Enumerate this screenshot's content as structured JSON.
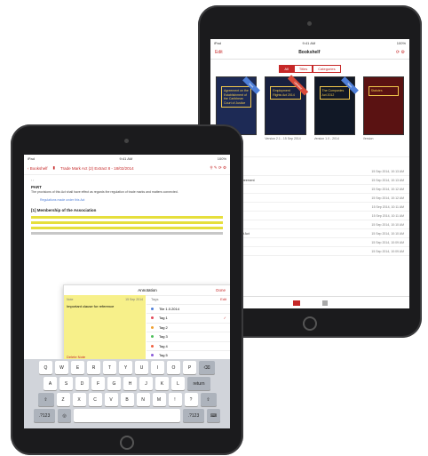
{
  "back": {
    "status_left": "iPad",
    "status_center": "9:41 AM",
    "status_right": "100%",
    "nav_left": "Edit",
    "nav_title": "Bookshelf",
    "segments": [
      {
        "label": "All",
        "active": true
      },
      {
        "label": "Titles",
        "active": false
      },
      {
        "label": "Categories",
        "active": false
      }
    ],
    "books": [
      {
        "title": "Agreement on the Establishment of the Caribbean Court of Justice",
        "bg": "#1d2a55",
        "ribbon": "New",
        "ribbon_color": "#4f7fd8",
        "meta": "Caribbean"
      },
      {
        "title": "Employment Rights Act 2014",
        "bg": "#18203f",
        "ribbon": "Updated",
        "ribbon_color": "#d94a3a",
        "meta": "Version 2.1 - 15 Sep 2014"
      },
      {
        "title": "The Companies Act 2012",
        "bg": "#111826",
        "ribbon": "New",
        "ribbon_color": "#4f7fd8",
        "meta": "Version 1.0 - 2014"
      },
      {
        "title": "Statutes",
        "bg": "#5a1212",
        "ribbon": "",
        "ribbon_color": "",
        "meta": "Version"
      }
    ],
    "section_label": "Recent",
    "recent": [
      {
        "name": "Limitation Act",
        "date": "15 Sep 2014, 10:13 AM"
      },
      {
        "name": "Companies Act - Agreement",
        "date": "15 Sep 2014, 10:13 AM"
      },
      {
        "name": "Arbitration Act",
        "date": "15 Sep 2014, 10:12 AM"
      },
      {
        "name": "Evidence Act",
        "date": "15 Sep 2014, 10:12 AM"
      },
      {
        "name": "Partnership Act",
        "date": "15 Sep 2014, 10:11 AM"
      },
      {
        "name": "Insurance Act",
        "date": "15 Sep 2014, 10:11 AM"
      },
      {
        "name": "Banking Act",
        "date": "15 Sep 2014, 10:10 AM"
      },
      {
        "name": "Landlord and Tenant Act",
        "date": "15 Sep 2014, 10:10 AM"
      },
      {
        "name": "Trade Marks Act",
        "date": "15 Sep 2014, 10:09 AM"
      },
      {
        "name": "Sale of Goods Act",
        "date": "15 Sep 2014, 10:09 AM"
      }
    ]
  },
  "front": {
    "status_left": "iPad",
    "status_center": "9:41 AM",
    "status_right": "100%",
    "back_label": "Bookshelf",
    "doc_title": "Trade Mark Act (2) Extract 8 - 18/02/2014",
    "heading1": "PART",
    "para1": "The provisions of this Act shall have effect as regards the regulation of trade marks and matters connected.",
    "link_line": "Regulations made under this Act",
    "heading2": "[1] Membership of the Association",
    "popover_title": "Annotation",
    "popover_done": "Done",
    "note_label": "Note",
    "note_date": "15 Sep 2014",
    "note_text": "Important clause for reference",
    "note_delete": "Delete Note",
    "tags_header": "Tags",
    "tags_edit": "Edit",
    "tags": [
      {
        "name": "Tile 1.0.2014",
        "color": "#4f7fd8",
        "checked": false
      },
      {
        "name": "Tag 1",
        "color": "#e34a5a",
        "checked": true
      },
      {
        "name": "Tag 2",
        "color": "#f0a030",
        "checked": false
      },
      {
        "name": "Tag 3",
        "color": "#4cbf5a",
        "checked": false
      },
      {
        "name": "Tag 4",
        "color": "#f06040",
        "checked": false
      },
      {
        "name": "Tag 5",
        "color": "#8a5ad8",
        "checked": false
      }
    ],
    "keys_row1": [
      "Q",
      "W",
      "E",
      "R",
      "T",
      "Y",
      "U",
      "I",
      "O",
      "P"
    ],
    "keys_row2": [
      "A",
      "S",
      "D",
      "F",
      "G",
      "H",
      "J",
      "K",
      "L"
    ],
    "keys_row3": [
      "Z",
      "X",
      "C",
      "V",
      "B",
      "N",
      "M",
      "!",
      "?"
    ],
    "key_return": "return",
    "key_numbers": ".?123",
    "key_space": ""
  }
}
